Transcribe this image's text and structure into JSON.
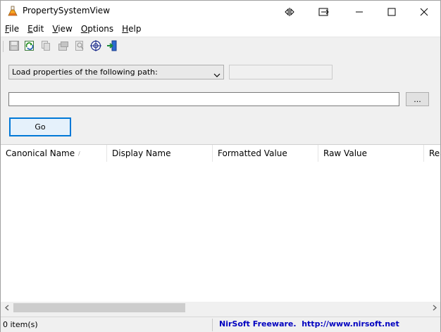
{
  "window": {
    "title": "PropertySystemView"
  },
  "menu": [
    {
      "label": "File",
      "accel": "F",
      "rest": "ile"
    },
    {
      "label": "Edit",
      "accel": "E",
      "rest": "dit"
    },
    {
      "label": "View",
      "accel": "V",
      "rest": "iew"
    },
    {
      "label": "Options",
      "accel": "O",
      "rest": "ptions"
    },
    {
      "label": "Help",
      "accel": "H",
      "rest": "elp"
    }
  ],
  "toolbar": {
    "icons": [
      "save-icon",
      "refresh-icon",
      "copy-icon",
      "properties-icon",
      "find-icon",
      "target-icon",
      "exit-icon"
    ]
  },
  "form": {
    "mode_select": "Load properties of the following path:",
    "path_value": "",
    "browse_label": "...",
    "go_label": "Go"
  },
  "list": {
    "columns": [
      "Canonical Name",
      "Display Name",
      "Formatted Value",
      "Raw Value",
      "Rea"
    ],
    "sort_indicator": "/",
    "rows": []
  },
  "status": {
    "count": "0 item(s)",
    "credit": "NirSoft Freeware.  http://www.nirsoft.net"
  },
  "colors": {
    "accent": "#0078d7",
    "credit_text": "#0000c0",
    "background": "#f0f0f0"
  }
}
